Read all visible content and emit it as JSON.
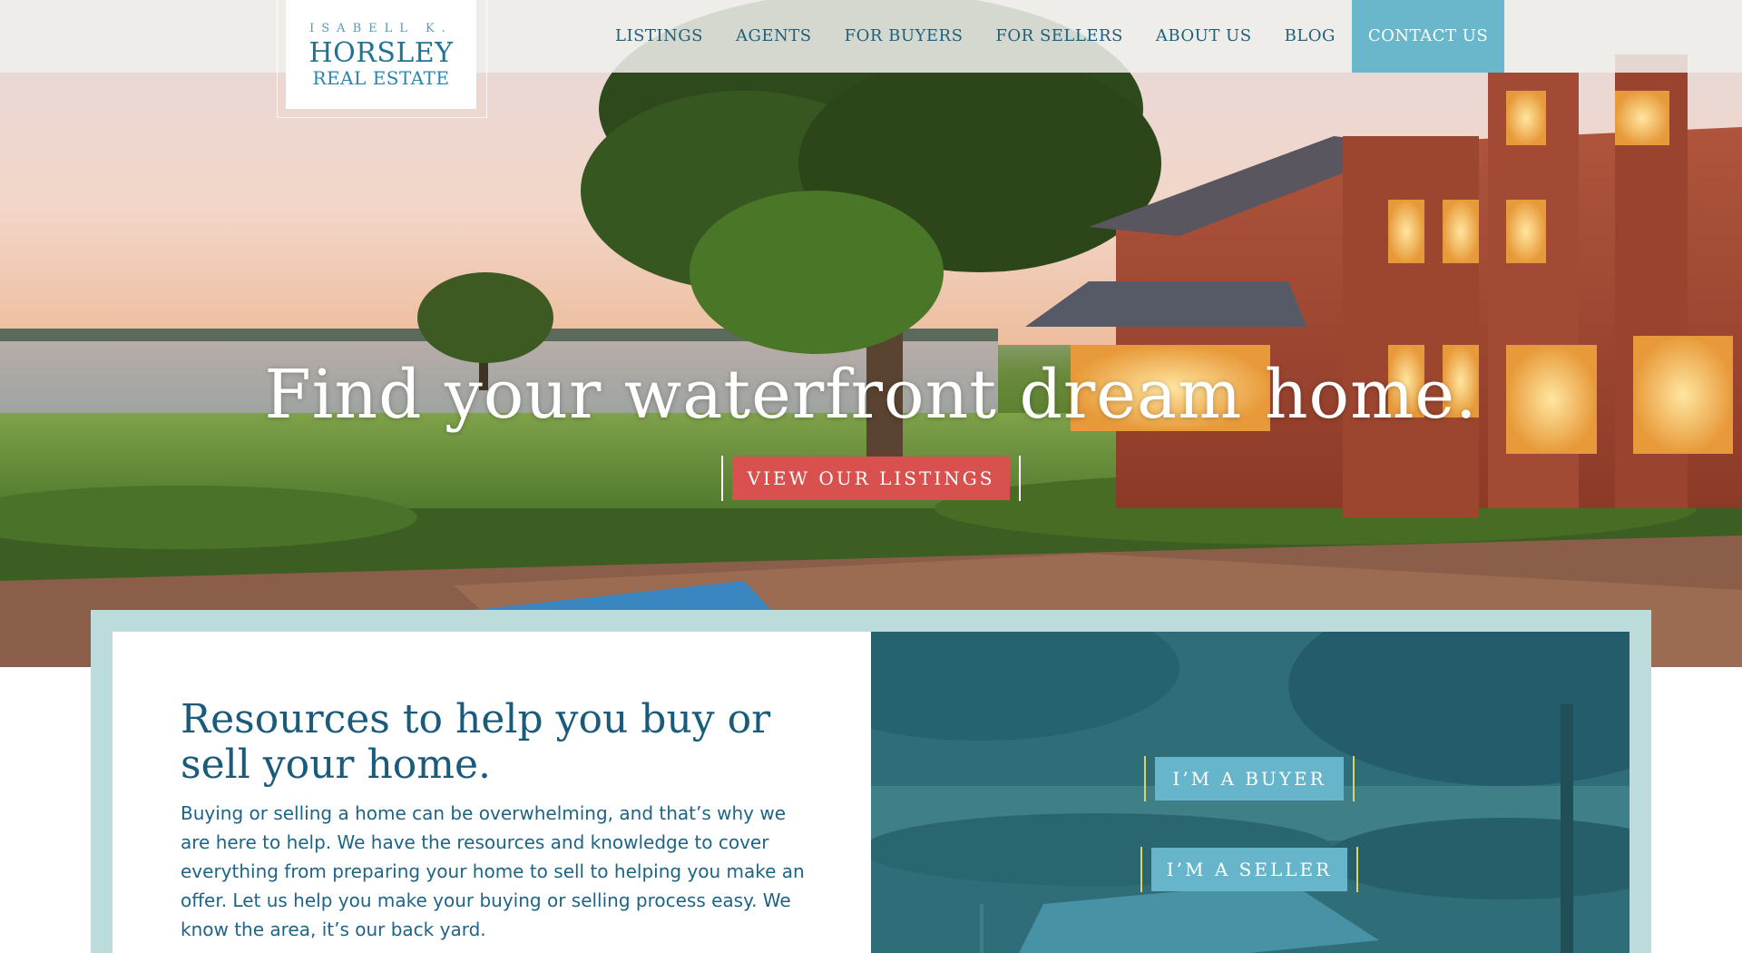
{
  "logo": {
    "line1": "ISABELL K.",
    "line2": "HORSLEY",
    "line3": "REAL ESTATE"
  },
  "nav": {
    "items": [
      {
        "label": "LISTINGS"
      },
      {
        "label": "AGENTS"
      },
      {
        "label": "FOR BUYERS"
      },
      {
        "label": "FOR SELLERS"
      },
      {
        "label": "ABOUT US"
      },
      {
        "label": "BLOG"
      },
      {
        "label": "CONTACT US"
      }
    ],
    "active_label": "CONTACT US"
  },
  "hero": {
    "headline": "Find your waterfront dream home.",
    "cta_label": "VIEW OUR LISTINGS"
  },
  "resources": {
    "title": "Resources to help you buy or sell your home.",
    "body": "Buying or selling a home can be overwhelming, and that’s why we are here to help. We have the resources and knowledge to cover everything from preparing your home to sell to helping you make an offer. Let us help you make your buying or selling process easy. We know the area, it’s our back yard.",
    "buyer_label": "I’M A BUYER",
    "seller_label": "I’M A SELLER"
  },
  "colors": {
    "brand_blue": "#1f7394",
    "accent_teal": "#6ab7cb",
    "cta_red": "#d9514f",
    "frame_mint": "#bcdcdb",
    "bar_yellow": "#d9d46a"
  }
}
